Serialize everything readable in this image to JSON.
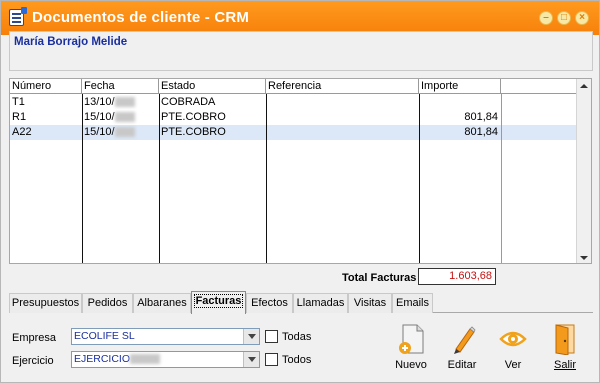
{
  "window": {
    "title": "Documentos de cliente - CRM",
    "controls": [
      "minimize-icon",
      "maximize-icon",
      "close-icon"
    ]
  },
  "client": {
    "name": "María Borrajo Melide"
  },
  "grid": {
    "columns": [
      "Número",
      "Fecha",
      "Estado",
      "Referencia",
      "Importe"
    ],
    "rows": [
      {
        "numero": "T1",
        "fecha": "13/10/",
        "estado": "COBRADA",
        "referencia": "",
        "importe": ""
      },
      {
        "numero": "R1",
        "fecha": "15/10/",
        "estado": "PTE.COBRO",
        "referencia": "",
        "importe": "801,84"
      },
      {
        "numero": "A22",
        "fecha": "15/10/",
        "estado": "PTE.COBRO",
        "referencia": "",
        "importe": "801,84"
      }
    ]
  },
  "totals": {
    "label": "Total Facturas",
    "value": "1.603,68"
  },
  "tabs": [
    "Presupuestos",
    "Pedidos",
    "Albaranes",
    "Facturas",
    "Efectos",
    "Llamadas",
    "Visitas",
    "Emails"
  ],
  "active_tab": "Facturas",
  "filters": {
    "empresa_label": "Empresa",
    "empresa_value": "ECOLIFE SL",
    "empresa_all": "Todas",
    "ejercicio_label": "Ejercicio",
    "ejercicio_value": "EJERCICIO",
    "ejercicio_all": "Todos"
  },
  "toolbar": {
    "nuevo": "Nuevo",
    "editar": "Editar",
    "ver": "Ver",
    "salir": "Salir"
  },
  "colors": {
    "titlebar": "#f7800a",
    "accent_blue": "#1a2f9e",
    "total_red": "#c61212",
    "row_highlight": "#dce8f8"
  }
}
